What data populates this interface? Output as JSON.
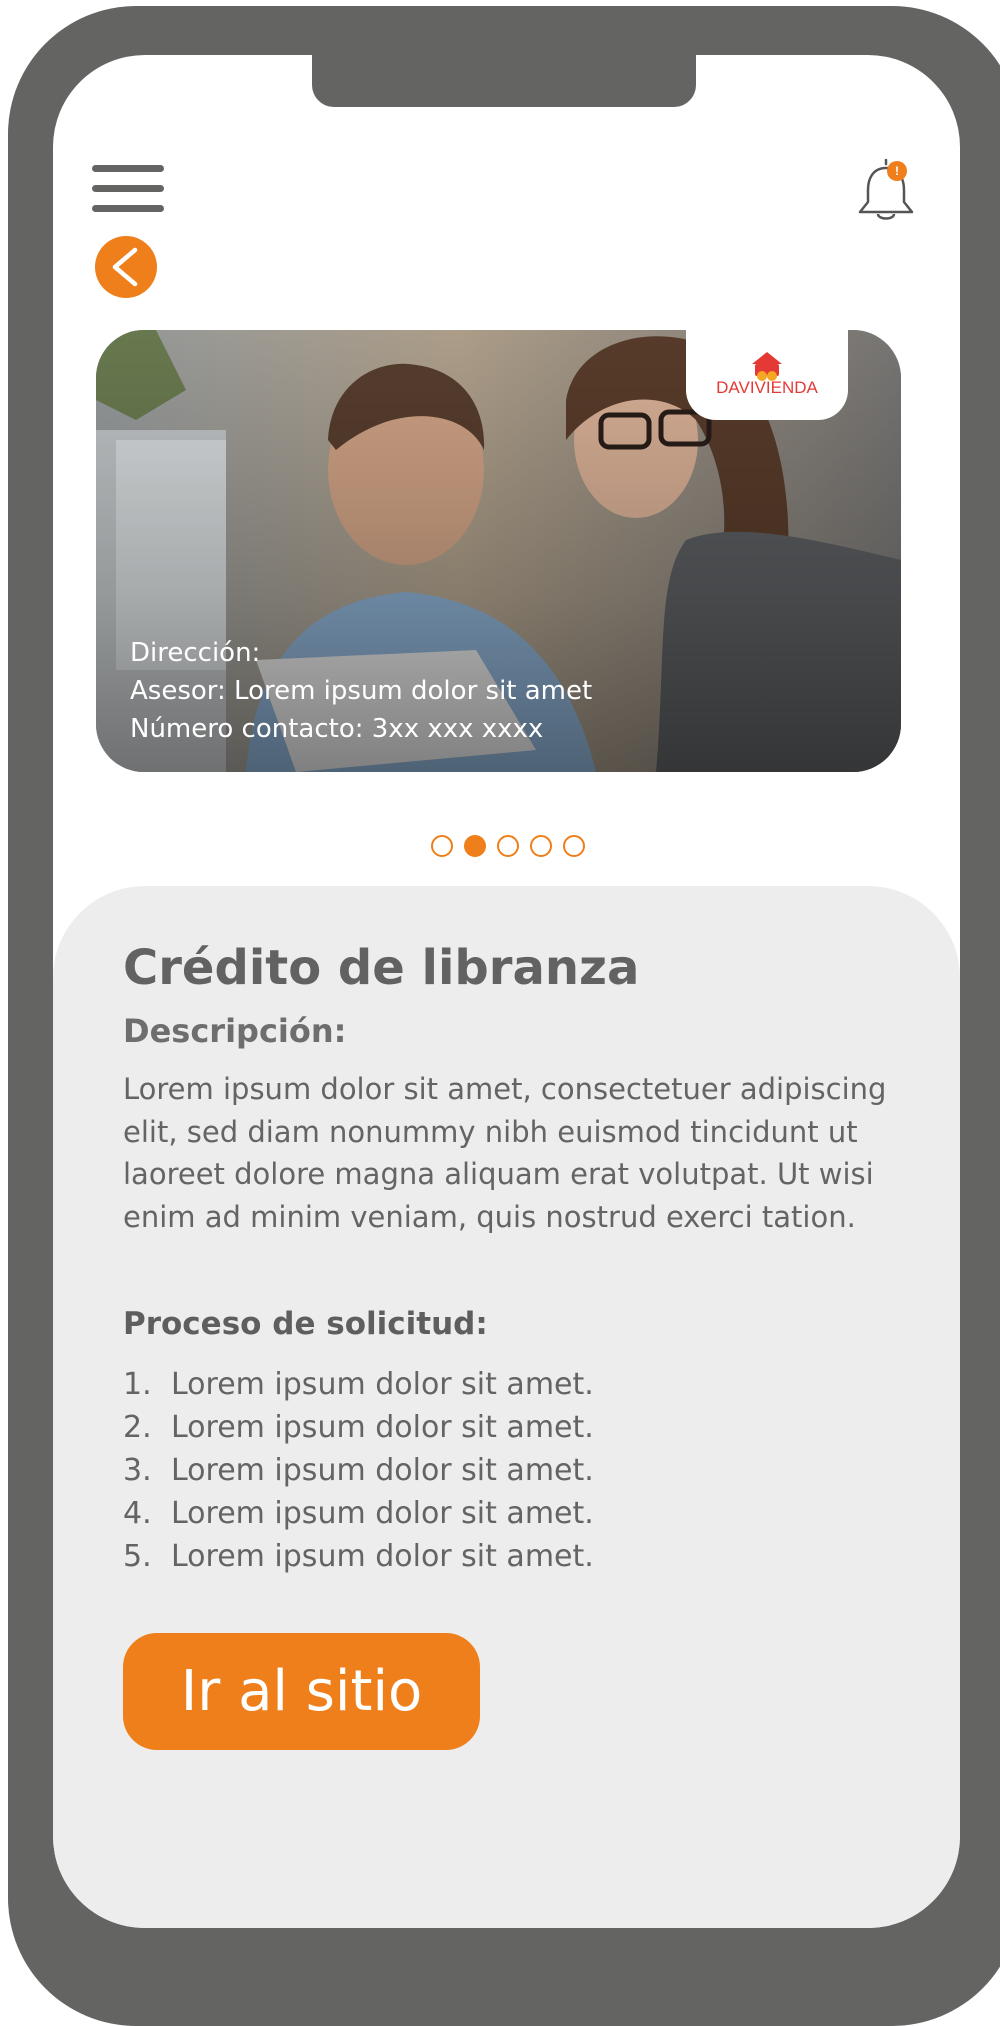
{
  "header": {
    "menu_icon": "hamburger-menu-icon",
    "notification_icon": "bell-icon",
    "notification_badge": "!",
    "back_icon": "chevron-left-icon"
  },
  "hero": {
    "logo_text": "DAVIVIENDA",
    "lines": [
      "Dirección:",
      "Asesor: Lorem ipsum dolor sit amet",
      "Número contacto: 3xx xxx xxxx"
    ]
  },
  "carousel": {
    "total": 5,
    "active_index": 1
  },
  "content": {
    "title": "Crédito de libranza",
    "description_label": "Descripción:",
    "description": "Lorem ipsum dolor sit amet, consectetuer adipiscing elit, sed diam nonummy nibh euismod tincidunt ut laoreet dolore magna aliquam erat volutpat. Ut wisi enim ad minim veniam, quis nostrud exerci tation.",
    "process_label": "Proceso de solicitud:",
    "steps": [
      {
        "num": "1.",
        "text": "Lorem ipsum dolor sit amet."
      },
      {
        "num": "2.",
        "text": "Lorem ipsum dolor sit amet."
      },
      {
        "num": "3.",
        "text": "Lorem ipsum dolor sit amet."
      },
      {
        "num": "4.",
        "text": "Lorem ipsum dolor sit amet."
      },
      {
        "num": "5.",
        "text": "Lorem ipsum dolor sit amet."
      }
    ],
    "cta_label": "Ir al sitio"
  },
  "colors": {
    "accent": "#ef7f1a",
    "frame": "#646463",
    "panel": "#ededed",
    "text": "#646464"
  }
}
